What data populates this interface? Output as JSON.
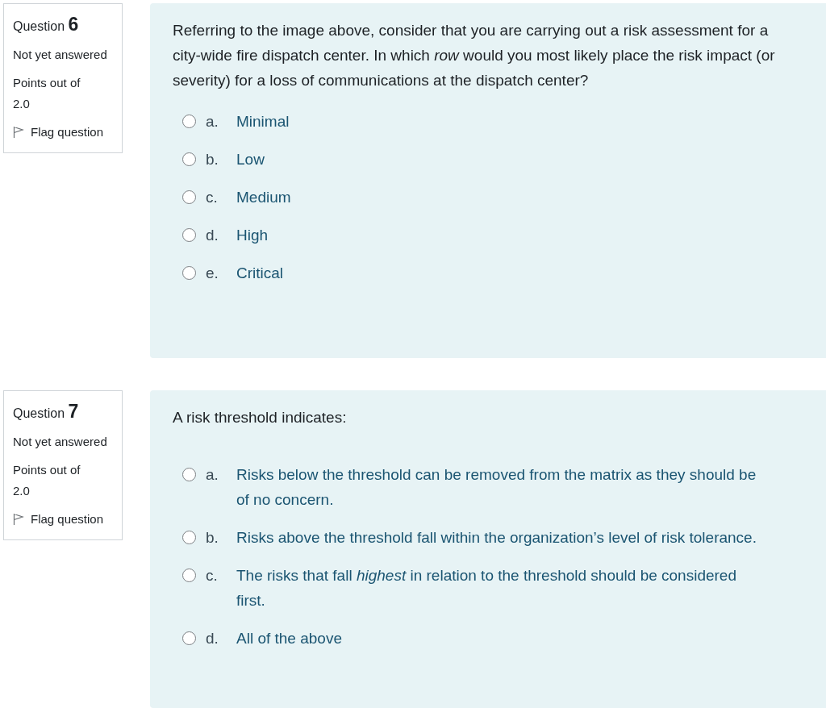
{
  "questions": [
    {
      "label": "Question",
      "number": "6",
      "status": "Not yet answered",
      "points_label": "Points out of",
      "points": "2.0",
      "flag": "Flag question",
      "text": "Referring to the image above, consider that you are carrying out a risk assessment for a city-wide fire dispatch center. In which *row* would you most likely place the risk impact (or severity) for a loss of communications at the dispatch center?",
      "options": [
        {
          "letter": "a.",
          "text": "Minimal",
          "selected": false
        },
        {
          "letter": "b.",
          "text": "Low",
          "selected": false
        },
        {
          "letter": "c.",
          "text": "Medium",
          "selected": false
        },
        {
          "letter": "d.",
          "text": "High",
          "selected": false
        },
        {
          "letter": "e.",
          "text": "Critical",
          "selected": false
        }
      ]
    },
    {
      "label": "Question",
      "number": "7",
      "status": "Not yet answered",
      "points_label": "Points out of",
      "points": "2.0",
      "flag": "Flag question",
      "text": "A risk threshold indicates:",
      "options": [
        {
          "letter": "a.",
          "text": "Risks below the threshold can be removed from the matrix as they should be of no concern.",
          "selected": false
        },
        {
          "letter": "b.",
          "text": "Risks above the threshold fall within the organization’s level of risk tolerance.",
          "selected": false
        },
        {
          "letter": "c.",
          "text": "The risks that fall *highest* in relation to the threshold should be considered first.",
          "selected": false
        },
        {
          "letter": "d.",
          "text": "All of the above",
          "selected": false
        }
      ]
    }
  ]
}
